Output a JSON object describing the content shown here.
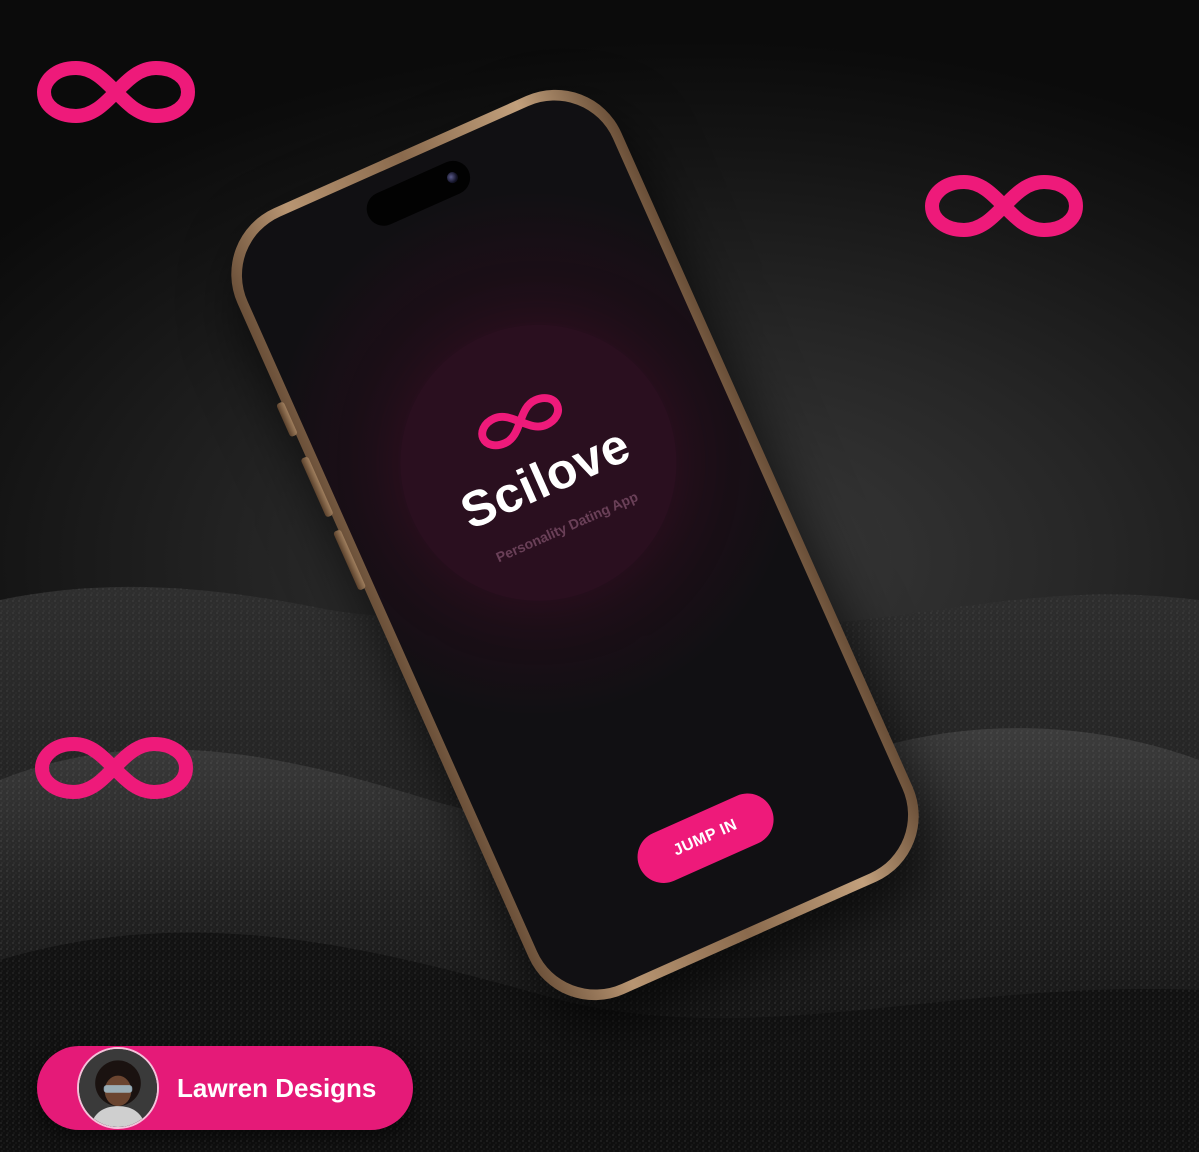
{
  "app": {
    "name": "Scilove",
    "tagline": "Personality Dating App",
    "cta_label": "JUMP IN",
    "logo_icon": "infinity-icon"
  },
  "decorations": {
    "floating_icons": [
      "infinity-icon",
      "infinity-icon",
      "infinity-icon"
    ]
  },
  "credit": {
    "name": "Lawren Designs",
    "avatar_icon": "avatar-photo"
  },
  "colors": {
    "accent": "#ee1a7a",
    "background": "#1a1a1a",
    "screen": "#111013",
    "circle": "#2a0f1f",
    "frame": "#b89572"
  }
}
